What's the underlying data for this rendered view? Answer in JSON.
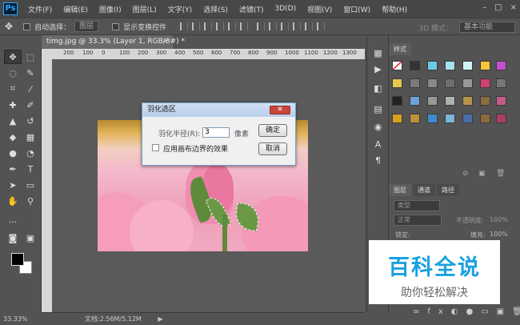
{
  "app": {
    "logo": "Ps"
  },
  "menu": [
    "文件(F)",
    "编辑(E)",
    "图像(I)",
    "图层(L)",
    "文字(Y)",
    "选择(S)",
    "滤镜(T)",
    "3D(D)",
    "视图(V)",
    "窗口(W)",
    "帮助(H)"
  ],
  "window_controls": {
    "minimize": "–",
    "maximize": "□",
    "close": "×"
  },
  "options_bar": {
    "move_icon": "✥",
    "auto_select_label": "自动选择：",
    "auto_select_value": "图层",
    "show_transform_label": "显示变换控件",
    "mode_3d_label": "3D 模式：",
    "workspace": "基本功能"
  },
  "document": {
    "tab_title": "timg.jpg @ 33.3% (Layer 1, RGB/8#) *",
    "close": "×"
  },
  "ruler": {
    "ticks": [
      "200",
      "100",
      "0",
      "100",
      "200",
      "300",
      "400",
      "500",
      "600",
      "700",
      "800",
      "900",
      "1000",
      "1100",
      "1200",
      "1300"
    ]
  },
  "dialog": {
    "title": "羽化选区",
    "close": "✕",
    "radius_label": "羽化半径(R):",
    "radius_value": "3",
    "unit": "像素",
    "ok": "确定",
    "cancel": "取消",
    "checkbox_label": "应用画布边界的效果"
  },
  "status": {
    "zoom": "33.33%",
    "doc_info": "文档:2.56M/5.12M",
    "arrow": "▶"
  },
  "panels": {
    "styles_tab": "样式",
    "layers_tabs": [
      "图层",
      "通道",
      "路径"
    ],
    "kind_label": "类型",
    "blend_mode": "正常",
    "opacity_label": "不透明度:",
    "opacity_value": "100%",
    "lock_label": "锁定:",
    "fill_label": "填充:",
    "fill_value": "100%"
  },
  "watermark": {
    "title": "百科全说",
    "subtitle": "助你轻松解决"
  },
  "colors": {
    "accent": "#31a8ff",
    "watermark_blue": "#19a1e0"
  }
}
